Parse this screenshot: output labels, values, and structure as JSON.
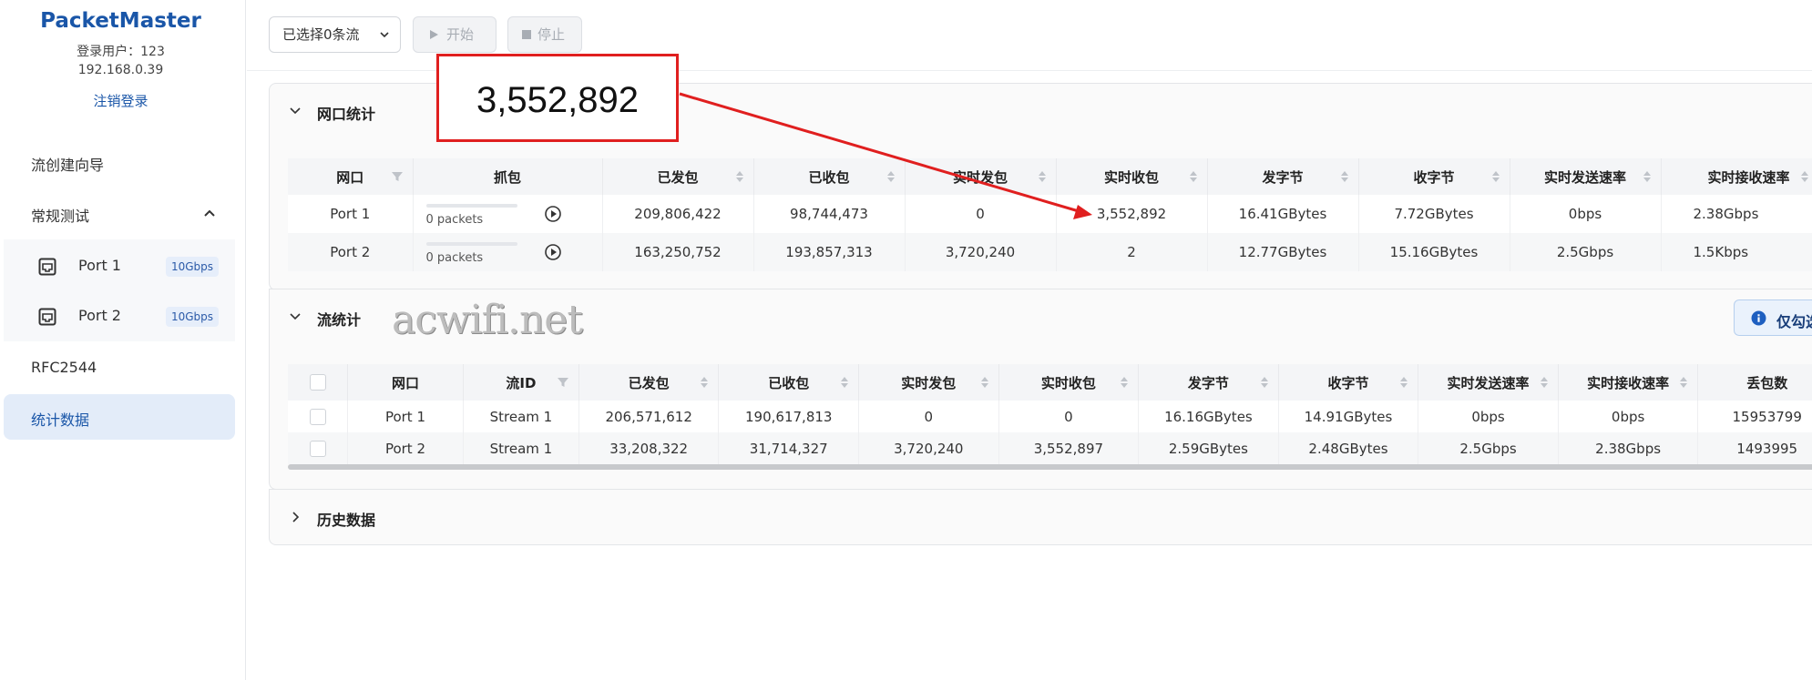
{
  "sidebar": {
    "brand": "PacketMaster",
    "user": "登录用户：123",
    "ip": "192.168.0.39",
    "logout": "注销登录",
    "nav_wizard": "流创建向导",
    "nav_regular": "常规测试",
    "ports": [
      {
        "label": "Port 1",
        "speed": "10Gbps"
      },
      {
        "label": "Port 2",
        "speed": "10Gbps"
      }
    ],
    "nav_rfc": "RFC2544",
    "nav_stats": "统计数据"
  },
  "toolbar": {
    "select_label": "已选择0条流",
    "start_label": "开始",
    "stop_label": "停止"
  },
  "callout": {
    "value": "3,552,892"
  },
  "watermark": "acwifi.net",
  "port_stats": {
    "title": "网口统计",
    "columns": [
      "网口",
      "抓包",
      "已发包",
      "已收包",
      "实时发包",
      "实时收包",
      "发字节",
      "收字节",
      "实时发送速率",
      "实时接收速率"
    ],
    "rows": [
      {
        "port": "Port 1",
        "capture": "0 packets",
        "tx": "209,806,422",
        "rx": "98,744,473",
        "rt_tx": "0",
        "rt_rx": "3,552,892",
        "tx_bytes": "16.41GBytes",
        "rx_bytes": "7.72GBytes",
        "tx_rate": "0bps",
        "rx_rate": "2.38Gbps"
      },
      {
        "port": "Port 2",
        "capture": "0 packets",
        "tx": "163,250,752",
        "rx": "193,857,313",
        "rt_tx": "3,720,240",
        "rt_rx": "2",
        "tx_bytes": "12.77GBytes",
        "rx_bytes": "15.16GBytes",
        "tx_rate": "2.5Gbps",
        "rx_rate": "1.5Kbps"
      }
    ]
  },
  "flow_stats": {
    "title": "流统计",
    "info_label": "仅勾选",
    "columns": [
      "网口",
      "流ID",
      "已发包",
      "已收包",
      "实时发包",
      "实时收包",
      "发字节",
      "收字节",
      "实时发送速率",
      "实时接收速率",
      "丢包数"
    ],
    "rows": [
      {
        "port": "Port 1",
        "stream": "Stream 1",
        "tx": "206,571,612",
        "rx": "190,617,813",
        "rt_tx": "0",
        "rt_rx": "0",
        "tx_bytes": "16.16GBytes",
        "rx_bytes": "14.91GBytes",
        "tx_rate": "0bps",
        "rx_rate": "0bps",
        "loss": "15953799"
      },
      {
        "port": "Port 2",
        "stream": "Stream 1",
        "tx": "33,208,322",
        "rx": "31,714,327",
        "rt_tx": "3,720,240",
        "rt_rx": "3,552,897",
        "tx_bytes": "2.59GBytes",
        "rx_bytes": "2.48GBytes",
        "tx_rate": "2.5Gbps",
        "rx_rate": "2.38Gbps",
        "loss": "1493995"
      }
    ]
  },
  "history": {
    "title": "历史数据"
  },
  "colors": {
    "brand": "#1a56a8",
    "callout_border": "#e01f1f",
    "active_nav_bg": "#e3ecf9"
  }
}
